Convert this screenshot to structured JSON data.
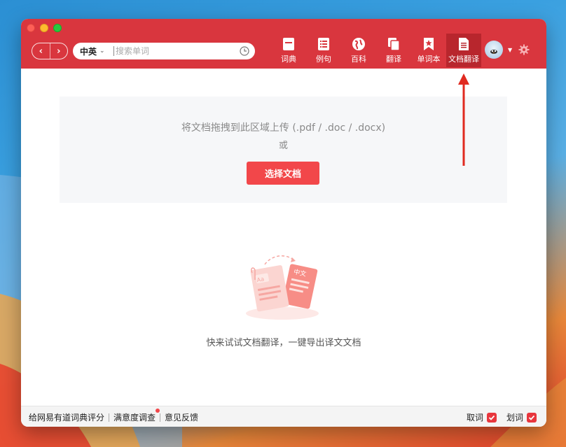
{
  "window": {
    "accent_color": "#d9363e"
  },
  "toolbar": {
    "back_label": "‹",
    "forward_label": "›",
    "language": "中英",
    "search_placeholder": "搜索单词",
    "tools": [
      {
        "label": "词典",
        "icon": "book-icon"
      },
      {
        "label": "例句",
        "icon": "list-icon"
      },
      {
        "label": "百科",
        "icon": "globe-icon"
      },
      {
        "label": "翻译",
        "icon": "copy-icon"
      },
      {
        "label": "单词本",
        "icon": "bookmark-star-icon"
      },
      {
        "label": "文档翻译",
        "icon": "document-icon",
        "active": true
      }
    ]
  },
  "dropzone": {
    "hint": "将文档拖拽到此区域上传 (.pdf / .doc / .docx)",
    "or": "或",
    "button_label": "选择文档"
  },
  "illustration": {
    "left_card_text": "Aa",
    "right_card_text": "中文"
  },
  "promo_text": "快来试试文档翻译，一键导出译文文档",
  "footer": {
    "rate_label": "给网易有道词典评分",
    "survey_label": "满意度调查",
    "feedback_label": "意见反馈",
    "toggle_lookup_label": "取词",
    "toggle_select_label": "划词",
    "toggle_lookup_checked": true,
    "toggle_select_checked": true
  }
}
